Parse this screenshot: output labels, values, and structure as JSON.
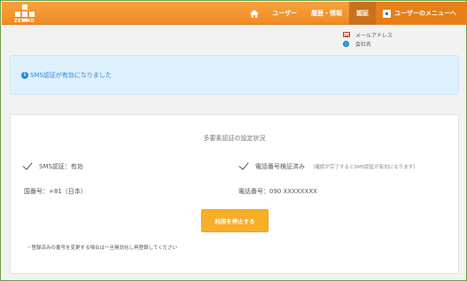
{
  "header": {
    "logo_text": "ZENMO",
    "nav": {
      "user": "ユーザー",
      "history": "履歴・情報",
      "auth": "認証",
      "user_menu": "ユーザーのメニューへ"
    }
  },
  "userinfo": {
    "email_label": "メールアドレス",
    "company_label": "会社名"
  },
  "notice": {
    "icon": "i",
    "text": "SMS認証が有効になりました"
  },
  "panel": {
    "title": "多要素認証の設定状況",
    "sms_status": "SMS認証：有効",
    "verified_status": "電話番号検証済み",
    "verified_note": "（確認が完了するとSMS認証が有効になります）",
    "country_code": "国番号：+81（日本）",
    "phone_number": "電話番号：090 XXXXXXXX",
    "stop_button": "利用を停止する",
    "footnote": "・登録済みの番号を変更する場合は一旦無効化し再登録してください"
  },
  "colors": {
    "header": "#f08b25",
    "active_nav": "#c8721c",
    "notice_bg": "#dff0fd",
    "notice_text": "#2a88d8",
    "button": "#f9ae27"
  },
  "icons": [
    "home-icon",
    "menu-icon",
    "mail-icon",
    "company-icon",
    "info-icon",
    "check-icon"
  ]
}
